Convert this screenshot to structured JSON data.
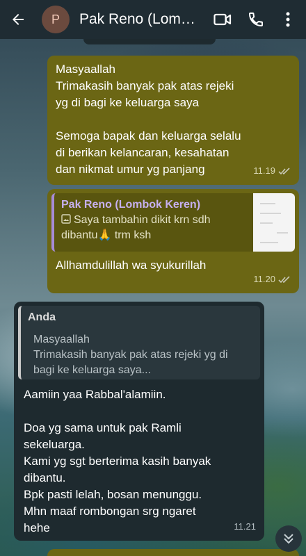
{
  "header": {
    "avatar_initial": "P",
    "title": "Pak Reno (Lombok Keren)",
    "icons": [
      "back-arrow-icon",
      "video-call-icon",
      "phone-call-icon",
      "more-vert-icon"
    ]
  },
  "messages": [
    {
      "direction": "outgoing",
      "text": "Masyaallah\nTrimakasih banyak pak atas rejeki\nyg di bagi ke keluarga saya\n\nSemoga bapak dan keluarga selalu\ndi berikan kelancaran, kesahatan\ndan nikmat umur yg panjang",
      "time": "11.19",
      "status": "read"
    },
    {
      "direction": "outgoing",
      "quote": {
        "author": "Pak Reno (Lombok Keren)",
        "text": "Saya tambahin dikit krn sdh dibantu🙏 trm ksh",
        "icon": "image-icon"
      },
      "text": "Allhamdulillah wa syukurillah",
      "time": "11.20",
      "status": "read"
    },
    {
      "direction": "incoming",
      "quote": {
        "author": "Anda",
        "text": "Masyaallah\nTrimakasih banyak pak atas rejeki yg di bagi ke keluarga saya..."
      },
      "text": "Aamiin yaa Rabbal'alamiin.\n\nDoa yg sama untuk pak Ramli\nsekeluarga.\nKami yg sgt berterima kasih banyak\ndibantu.\nBpk pasti lelah, bosan menunggu.\nMhn maaf rombongan srg ngaret\nhehe",
      "time": "11.21"
    }
  ],
  "colors": {
    "header_bg": "#1f2c33",
    "outgoing_bubble": "#6b6614",
    "incoming_bubble": "#1e2a2f",
    "quote_accent": "#a78bd6"
  }
}
